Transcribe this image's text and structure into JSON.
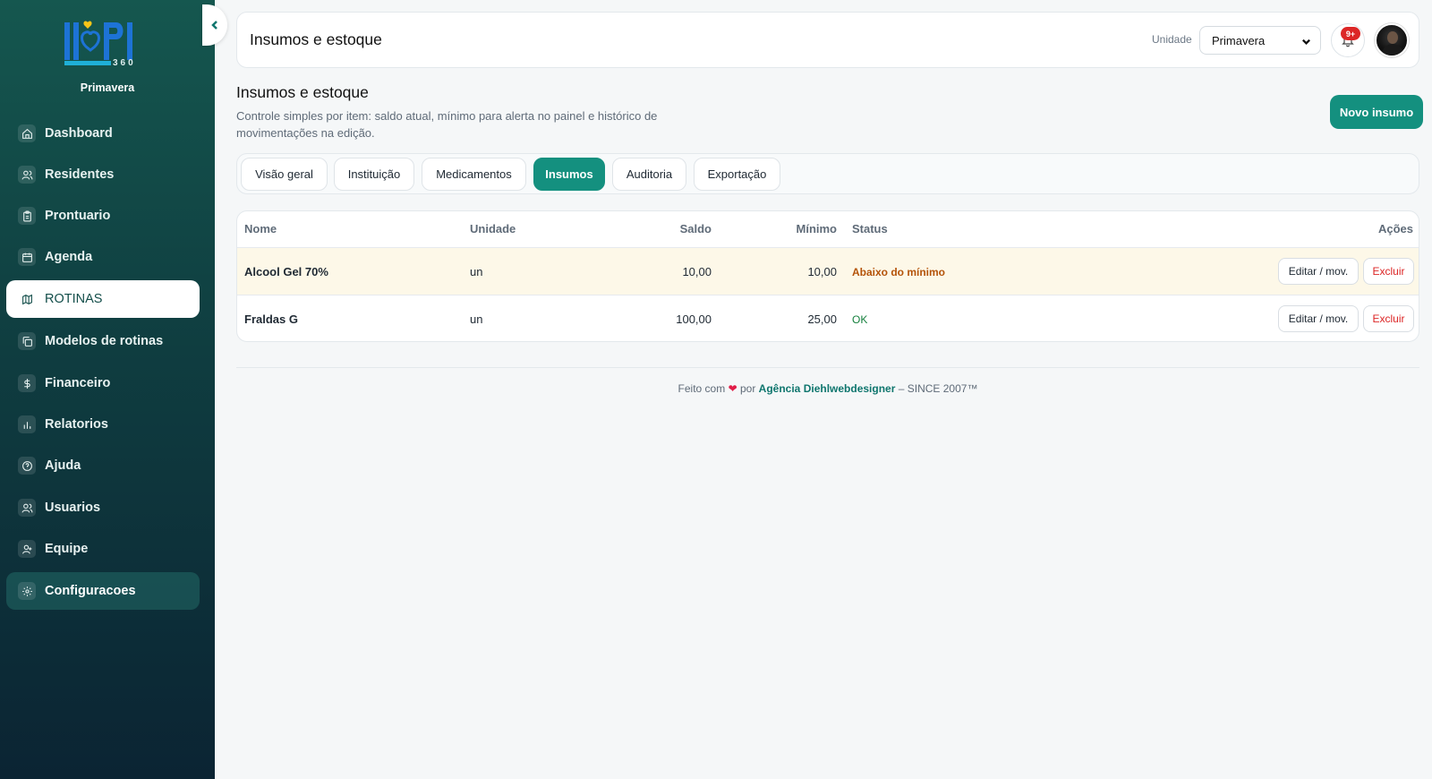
{
  "sidebar": {
    "unit_name": "Primavera",
    "logo_digits": "360",
    "items": [
      {
        "label": "Dashboard",
        "icon": "home-icon"
      },
      {
        "label": "Residentes",
        "icon": "users-icon"
      },
      {
        "label": "Prontuario",
        "icon": "clipboard-icon"
      },
      {
        "label": "Agenda",
        "icon": "calendar-icon"
      },
      {
        "label": "ROTINAS",
        "icon": "map-icon"
      },
      {
        "label": "Modelos de rotinas",
        "icon": "copy-icon"
      },
      {
        "label": "Financeiro",
        "icon": "dollar-icon"
      },
      {
        "label": "Relatorios",
        "icon": "bar-chart-icon"
      },
      {
        "label": "Ajuda",
        "icon": "help-icon"
      },
      {
        "label": "Usuarios",
        "icon": "users-icon"
      },
      {
        "label": "Equipe",
        "icon": "team-icon"
      },
      {
        "label": "Configuracoes",
        "icon": "settings-icon"
      }
    ]
  },
  "header": {
    "title": "Insumos e estoque",
    "unit_label": "Unidade",
    "unit_selected": "Primavera",
    "notification_badge": "9+"
  },
  "page": {
    "title": "Insumos e estoque",
    "description": "Controle simples por item: saldo atual, mínimo para alerta no painel e histórico de movimentações na edição.",
    "new_button": "Novo insumo"
  },
  "tabs": [
    {
      "label": "Visão geral",
      "active": false
    },
    {
      "label": "Instituição",
      "active": false
    },
    {
      "label": "Medicamentos",
      "active": false
    },
    {
      "label": "Insumos",
      "active": true
    },
    {
      "label": "Auditoria",
      "active": false
    },
    {
      "label": "Exportação",
      "active": false
    }
  ],
  "table": {
    "headers": {
      "nome": "Nome",
      "unidade": "Unidade",
      "saldo": "Saldo",
      "minimo": "Mínimo",
      "status": "Status",
      "acoes": "Ações"
    },
    "rows": [
      {
        "nome": "Alcool Gel 70%",
        "unidade": "un",
        "saldo": "10,00",
        "minimo": "10,00",
        "status": "Abaixo do mínimo",
        "edit": "Editar / mov.",
        "delete": "Excluir"
      },
      {
        "nome": "Fraldas G",
        "unidade": "un",
        "saldo": "100,00",
        "minimo": "25,00",
        "status": "OK",
        "edit": "Editar / mov.",
        "delete": "Excluir"
      }
    ]
  },
  "footer": {
    "prefix": "Feito com",
    "by": "por",
    "agency": "Agência Diehlwebdesigner",
    "suffix": "– SINCE 2007™"
  },
  "colors": {
    "accent": "#14907f",
    "danger": "#dc2626",
    "warn": "#b45309",
    "ok": "#15803d"
  }
}
